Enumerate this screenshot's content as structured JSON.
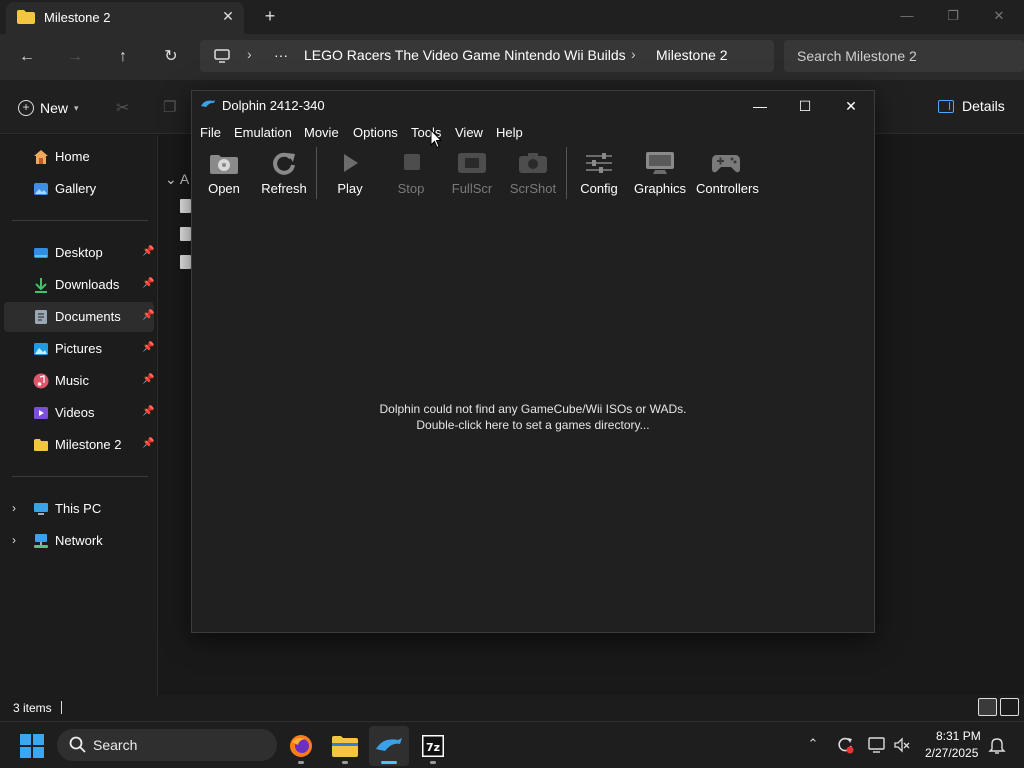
{
  "explorer": {
    "tab_title": "Milestone 2",
    "breadcrumb": [
      "LEGO Racers The Video Game Nintendo Wii Builds",
      "Milestone 2"
    ],
    "breadcrumb_more": "···",
    "search_placeholder": "Search Milestone 2",
    "toolbar": {
      "new_label": "New",
      "details_label": "Details"
    },
    "sidebar": {
      "items": [
        {
          "label": "Home",
          "icon": "home-icon"
        },
        {
          "label": "Gallery",
          "icon": "gallery-icon"
        },
        {
          "label": "Desktop",
          "icon": "desktop-icon",
          "pinned": true
        },
        {
          "label": "Downloads",
          "icon": "downloads-icon",
          "pinned": true
        },
        {
          "label": "Documents",
          "icon": "documents-icon",
          "pinned": true,
          "selected": true
        },
        {
          "label": "Pictures",
          "icon": "pictures-icon",
          "pinned": true
        },
        {
          "label": "Music",
          "icon": "music-icon",
          "pinned": true
        },
        {
          "label": "Videos",
          "icon": "videos-icon",
          "pinned": true
        },
        {
          "label": "Milestone 2",
          "icon": "folder-icon",
          "pinned": true
        },
        {
          "label": "This PC",
          "icon": "this-pc-icon"
        },
        {
          "label": "Network",
          "icon": "network-icon"
        }
      ]
    },
    "content_group_letter": "A",
    "status": {
      "items_count": "3 items"
    }
  },
  "dolphin": {
    "title": "Dolphin 2412-340",
    "menu": [
      "File",
      "Emulation",
      "Movie",
      "Options",
      "Tools",
      "View",
      "Help"
    ],
    "toolbar": [
      {
        "label": "Open",
        "enabled": true,
        "icon": "open-icon"
      },
      {
        "label": "Refresh",
        "enabled": true,
        "icon": "refresh-icon"
      },
      {
        "label": "Play",
        "enabled": true,
        "icon": "play-icon"
      },
      {
        "label": "Stop",
        "enabled": false,
        "icon": "stop-icon"
      },
      {
        "label": "FullScr",
        "enabled": false,
        "icon": "fullscreen-icon"
      },
      {
        "label": "ScrShot",
        "enabled": false,
        "icon": "screenshot-icon"
      },
      {
        "label": "Config",
        "enabled": true,
        "icon": "config-icon"
      },
      {
        "label": "Graphics",
        "enabled": true,
        "icon": "graphics-icon"
      },
      {
        "label": "Controllers",
        "enabled": true,
        "icon": "controllers-icon"
      }
    ],
    "message_line1": "Dolphin could not find any GameCube/Wii ISOs or WADs.",
    "message_line2": "Double-click here to set a games directory..."
  },
  "taskbar": {
    "search_label": "Search",
    "apps": [
      "firefox-icon",
      "file-explorer-icon",
      "dolphin-icon",
      "7zip-icon"
    ],
    "active_app": "dolphin-icon",
    "time": "8:31 PM",
    "date": "2/27/2025"
  },
  "colors": {
    "accent": "#4cc2ff",
    "folder": "#f4c542",
    "window_bg": "#202020"
  }
}
